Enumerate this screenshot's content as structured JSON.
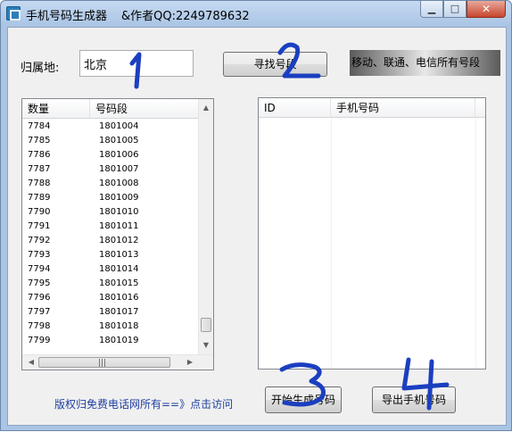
{
  "window": {
    "title": "手机号码生成器",
    "author": "&作者QQ:2249789632",
    "min_glyph": "▁",
    "max_glyph": "□",
    "close_glyph": "✕"
  },
  "region": {
    "label": "归属地:",
    "value": "北京"
  },
  "buttons": {
    "find": "寻找号段",
    "generate": "开始生成号码",
    "export": "导出手机号码"
  },
  "banner": "移动、联通、电信所有号段",
  "segment_list": {
    "columns": [
      "数量",
      "号码段"
    ],
    "rows": [
      [
        "7784",
        "1801004"
      ],
      [
        "7785",
        "1801005"
      ],
      [
        "7786",
        "1801006"
      ],
      [
        "7787",
        "1801007"
      ],
      [
        "7788",
        "1801008"
      ],
      [
        "7789",
        "1801009"
      ],
      [
        "7790",
        "1801010"
      ],
      [
        "7791",
        "1801011"
      ],
      [
        "7792",
        "1801012"
      ],
      [
        "7793",
        "1801013"
      ],
      [
        "7794",
        "1801014"
      ],
      [
        "7795",
        "1801015"
      ],
      [
        "7796",
        "1801016"
      ],
      [
        "7797",
        "1801017"
      ],
      [
        "7798",
        "1801018"
      ],
      [
        "7799",
        "1801019"
      ]
    ],
    "scroll_position": 0.97
  },
  "phone_list": {
    "columns": [
      "ID",
      "手机号码"
    ],
    "rows": []
  },
  "footer_link": "版权归免费电话网所有==》点击访问",
  "annotations": [
    "1",
    "2",
    "3",
    "4"
  ],
  "colors": {
    "annotation_ink": "#1a3fc0",
    "link": "#1f3fa0",
    "title_gradient_top": "#c6daf1",
    "close_button": "#c7462f"
  },
  "icons": {
    "app": "app-icon",
    "scroll_up": "arrow-up-icon",
    "scroll_down": "arrow-down-icon",
    "scroll_left": "arrow-left-icon",
    "scroll_right": "arrow-right-icon"
  }
}
